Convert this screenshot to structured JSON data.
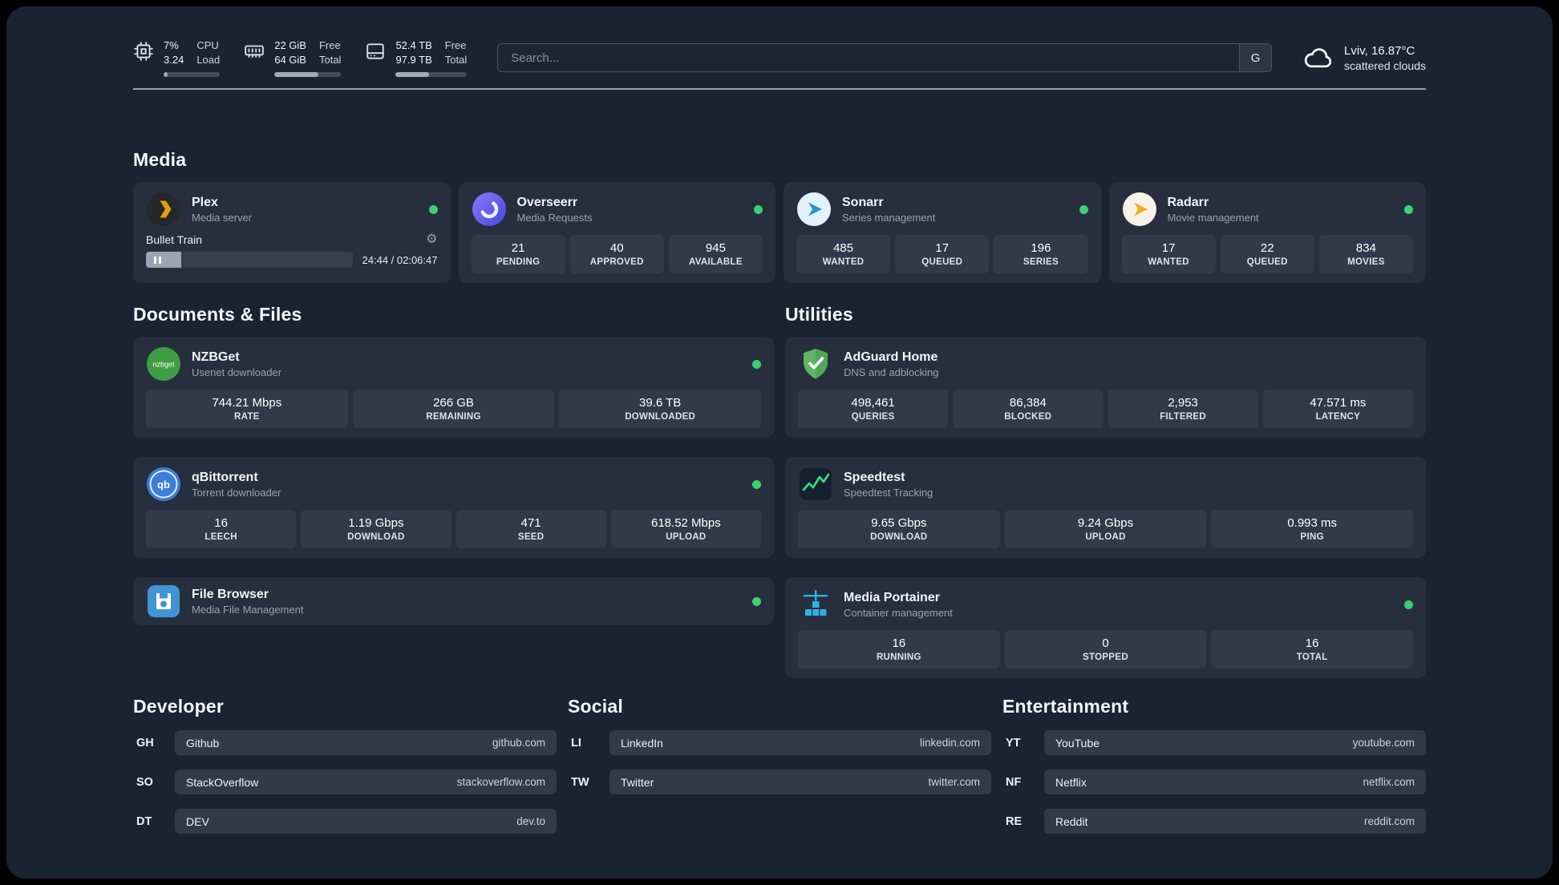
{
  "colors": {
    "online_dot": "#3ecf72",
    "plex_amber": "#e5a00d",
    "background": "#1a2332",
    "card": "#272f3e"
  },
  "topbar": {
    "cpu": {
      "value": "7%",
      "sub": "3.24",
      "label_top": "CPU",
      "label_bottom": "Load",
      "percent": 7
    },
    "memory": {
      "value": "22 GiB",
      "sub": "64 GiB",
      "label_top": "Free",
      "label_bottom": "Total",
      "percent": 66
    },
    "disk": {
      "value": "52.4 TB",
      "sub": "97.9 TB",
      "label_top": "Free",
      "label_bottom": "Total",
      "percent": 47
    },
    "search": {
      "placeholder": "Search...",
      "engine_letter": "G"
    },
    "weather": {
      "location": "Lviv, 16.87°C",
      "condition": "scattered clouds"
    }
  },
  "sections": {
    "media": {
      "title": "Media",
      "cards": [
        {
          "name": "Plex",
          "subtitle": "Media server",
          "online": true,
          "player": {
            "track": "Bullet Train",
            "time": "24:44 / 02:06:47",
            "progress_percent": 17
          }
        },
        {
          "name": "Overseerr",
          "subtitle": "Media Requests",
          "online": true,
          "stats": [
            {
              "value": "21",
              "label": "PENDING"
            },
            {
              "value": "40",
              "label": "APPROVED"
            },
            {
              "value": "945",
              "label": "AVAILABLE"
            }
          ]
        },
        {
          "name": "Sonarr",
          "subtitle": "Series management",
          "online": true,
          "stats": [
            {
              "value": "485",
              "label": "WANTED"
            },
            {
              "value": "17",
              "label": "QUEUED"
            },
            {
              "value": "196",
              "label": "SERIES"
            }
          ]
        },
        {
          "name": "Radarr",
          "subtitle": "Movie management",
          "online": true,
          "stats": [
            {
              "value": "17",
              "label": "WANTED"
            },
            {
              "value": "22",
              "label": "QUEUED"
            },
            {
              "value": "834",
              "label": "MOVIES"
            }
          ]
        }
      ]
    },
    "documents": {
      "title": "Documents & Files",
      "cards": [
        {
          "name": "NZBGet",
          "subtitle": "Usenet downloader",
          "online": true,
          "icon_text": "nzbget",
          "stats": [
            {
              "value": "744.21 Mbps",
              "label": "RATE"
            },
            {
              "value": "266 GB",
              "label": "REMAINING"
            },
            {
              "value": "39.6 TB",
              "label": "DOWNLOADED"
            }
          ]
        },
        {
          "name": "qBittorrent",
          "subtitle": "Torrent downloader",
          "online": true,
          "icon_text": "qb",
          "stats": [
            {
              "value": "16",
              "label": "LEECH"
            },
            {
              "value": "1.19 Gbps",
              "label": "DOWNLOAD"
            },
            {
              "value": "471",
              "label": "SEED"
            },
            {
              "value": "618.52 Mbps",
              "label": "UPLOAD"
            }
          ]
        },
        {
          "name": "File Browser",
          "subtitle": "Media File Management",
          "online": true
        }
      ]
    },
    "utilities": {
      "title": "Utilities",
      "cards": [
        {
          "name": "AdGuard Home",
          "subtitle": "DNS and adblocking",
          "stats": [
            {
              "value": "498,461",
              "label": "QUERIES"
            },
            {
              "value": "86,384",
              "label": "BLOCKED"
            },
            {
              "value": "2,953",
              "label": "FILTERED"
            },
            {
              "value": "47.571 ms",
              "label": "LATENCY"
            }
          ]
        },
        {
          "name": "Speedtest",
          "subtitle": "Speedtest Tracking",
          "stats": [
            {
              "value": "9.65 Gbps",
              "label": "DOWNLOAD"
            },
            {
              "value": "9.24 Gbps",
              "label": "UPLOAD"
            },
            {
              "value": "0.993 ms",
              "label": "PING"
            }
          ]
        },
        {
          "name": "Media Portainer",
          "subtitle": "Container management",
          "online": true,
          "stats": [
            {
              "value": "16",
              "label": "RUNNING"
            },
            {
              "value": "0",
              "label": "STOPPED"
            },
            {
              "value": "16",
              "label": "TOTAL"
            }
          ]
        }
      ]
    },
    "developer": {
      "title": "Developer",
      "links": [
        {
          "abbr": "GH",
          "name": "Github",
          "url": "github.com"
        },
        {
          "abbr": "SO",
          "name": "StackOverflow",
          "url": "stackoverflow.com"
        },
        {
          "abbr": "DT",
          "name": "DEV",
          "url": "dev.to"
        }
      ]
    },
    "social": {
      "title": "Social",
      "links": [
        {
          "abbr": "LI",
          "name": "LinkedIn",
          "url": "linkedin.com"
        },
        {
          "abbr": "TW",
          "name": "Twitter",
          "url": "twitter.com"
        }
      ]
    },
    "entertainment": {
      "title": "Entertainment",
      "links": [
        {
          "abbr": "YT",
          "name": "YouTube",
          "url": "youtube.com"
        },
        {
          "abbr": "NF",
          "name": "Netflix",
          "url": "netflix.com"
        },
        {
          "abbr": "RE",
          "name": "Reddit",
          "url": "reddit.com"
        }
      ]
    }
  }
}
